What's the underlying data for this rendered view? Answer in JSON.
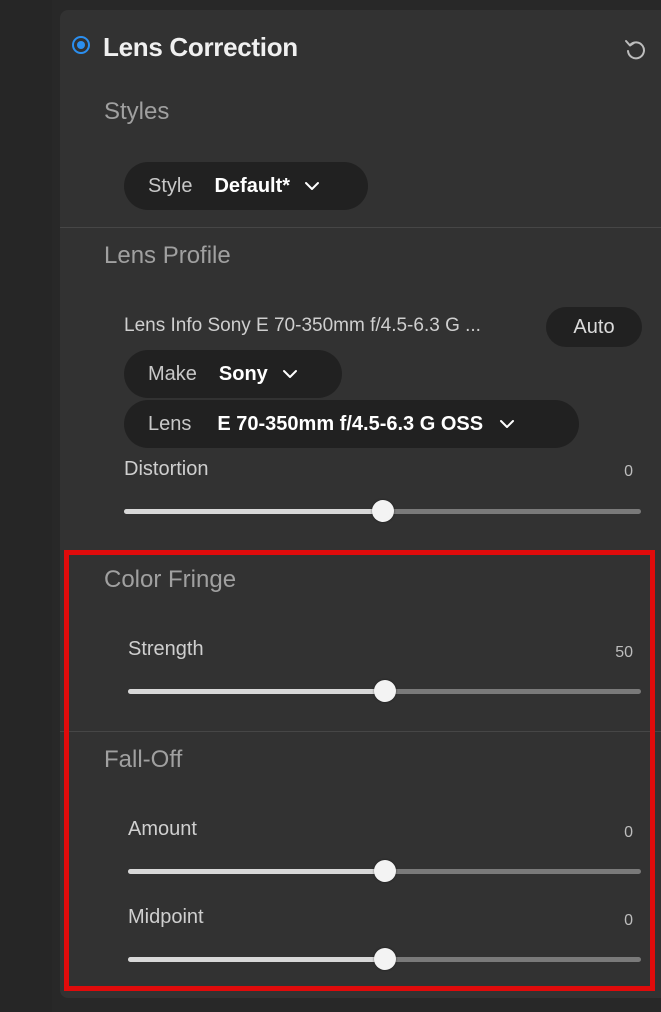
{
  "panel": {
    "title": "Lens Correction",
    "accent_color": "#2b8ff0",
    "header_icon": "radio-selected-icon",
    "reset_icon": "undo-icon"
  },
  "styles": {
    "section_title": "Styles",
    "style_label": "Style",
    "style_value": "Default*"
  },
  "lens_profile": {
    "section_title": "Lens Profile",
    "lens_info": "Lens Info Sony E 70-350mm f/4.5-6.3 G ...",
    "auto_button": "Auto",
    "make_label": "Make",
    "make_value": "Sony",
    "lens_label": "Lens",
    "lens_value": "E 70-350mm f/4.5-6.3 G OSS",
    "distortion": {
      "label": "Distortion",
      "value": "0",
      "position": 0.5
    }
  },
  "color_fringe": {
    "section_title": "Color Fringe",
    "strength": {
      "label": "Strength",
      "value": "50",
      "position": 0.5
    }
  },
  "fall_off": {
    "section_title": "Fall-Off",
    "amount": {
      "label": "Amount",
      "value": "0",
      "position": 0.5
    },
    "midpoint": {
      "label": "Midpoint",
      "value": "0",
      "position": 0.5
    }
  },
  "highlight_color": "#e00b0b"
}
